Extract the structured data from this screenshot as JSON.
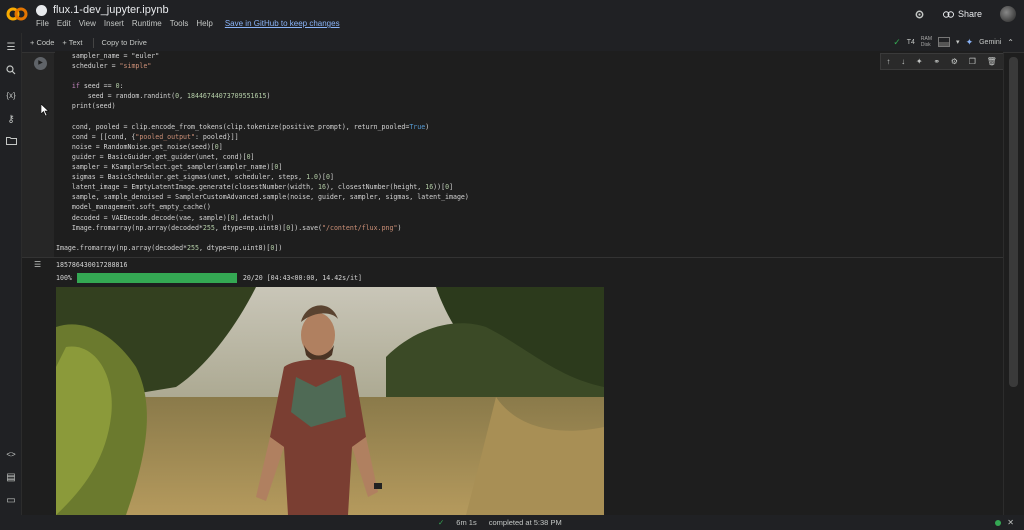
{
  "app": {
    "notebook_title": "flux.1-dev_jupyter.ipynb",
    "menu": [
      "File",
      "Edit",
      "View",
      "Insert",
      "Runtime",
      "Tools",
      "Help"
    ],
    "save_link": "Save in GitHub to keep changes",
    "share_label": "Share"
  },
  "toolbar": {
    "code_label": "+ Code",
    "text_label": "+ Text",
    "copy_label": "Copy to Drive",
    "runtime_label": "T4",
    "ram_label": "RAM",
    "disk_label": "Disk",
    "gemini_label": "Gemini"
  },
  "code_lines": [
    {
      "segments": [
        {
          "t": "    sampler_name = \"euler\"",
          "c": ""
        }
      ]
    },
    {
      "segments": [
        {
          "t": "    scheduler = ",
          "c": ""
        },
        {
          "t": "\"simple\"",
          "c": "str"
        }
      ]
    },
    {
      "segments": [
        {
          "t": "",
          "c": ""
        }
      ]
    },
    {
      "segments": [
        {
          "t": "    ",
          "c": ""
        },
        {
          "t": "if",
          "c": "kw"
        },
        {
          "t": " seed == ",
          "c": ""
        },
        {
          "t": "0",
          "c": "num"
        },
        {
          "t": ":",
          "c": ""
        }
      ]
    },
    {
      "segments": [
        {
          "t": "        seed = random.randint(",
          "c": ""
        },
        {
          "t": "0",
          "c": "num"
        },
        {
          "t": ", ",
          "c": ""
        },
        {
          "t": "18446744073709551615",
          "c": "num"
        },
        {
          "t": ")",
          "c": ""
        }
      ]
    },
    {
      "segments": [
        {
          "t": "    print(seed)",
          "c": ""
        }
      ]
    },
    {
      "segments": [
        {
          "t": "",
          "c": ""
        }
      ]
    },
    {
      "segments": [
        {
          "t": "    cond, pooled = clip.encode_from_tokens(clip.tokenize(positive_prompt), return_pooled=",
          "c": ""
        },
        {
          "t": "True",
          "c": "bool"
        },
        {
          "t": ")",
          "c": ""
        }
      ]
    },
    {
      "segments": [
        {
          "t": "    cond = [[cond, {",
          "c": ""
        },
        {
          "t": "\"pooled_output\"",
          "c": "str"
        },
        {
          "t": ": pooled}]]",
          "c": ""
        }
      ]
    },
    {
      "segments": [
        {
          "t": "    noise = RandomNoise.get_noise(seed)[",
          "c": ""
        },
        {
          "t": "0",
          "c": "num"
        },
        {
          "t": "]",
          "c": ""
        }
      ]
    },
    {
      "segments": [
        {
          "t": "    guider = BasicGuider.get_guider(unet, cond)[",
          "c": ""
        },
        {
          "t": "0",
          "c": "num"
        },
        {
          "t": "]",
          "c": ""
        }
      ]
    },
    {
      "segments": [
        {
          "t": "    sampler = KSamplerSelect.get_sampler(sampler_name)[",
          "c": ""
        },
        {
          "t": "0",
          "c": "num"
        },
        {
          "t": "]",
          "c": ""
        }
      ]
    },
    {
      "segments": [
        {
          "t": "    sigmas = BasicScheduler.get_sigmas(unet, scheduler, steps, ",
          "c": ""
        },
        {
          "t": "1.0",
          "c": "num"
        },
        {
          "t": ")[",
          "c": ""
        },
        {
          "t": "0",
          "c": "num"
        },
        {
          "t": "]",
          "c": ""
        }
      ]
    },
    {
      "segments": [
        {
          "t": "    latent_image = EmptyLatentImage.generate(closestNumber(width, ",
          "c": ""
        },
        {
          "t": "16",
          "c": "num"
        },
        {
          "t": "), closestNumber(height, ",
          "c": ""
        },
        {
          "t": "16",
          "c": "num"
        },
        {
          "t": "))[",
          "c": ""
        },
        {
          "t": "0",
          "c": "num"
        },
        {
          "t": "]",
          "c": ""
        }
      ]
    },
    {
      "segments": [
        {
          "t": "    sample, sample_denoised = SamplerCustomAdvanced.sample(noise, guider, sampler, sigmas, latent_image)",
          "c": ""
        }
      ]
    },
    {
      "segments": [
        {
          "t": "    model_management.soft_empty_cache()",
          "c": ""
        }
      ]
    },
    {
      "segments": [
        {
          "t": "    decoded = VAEDecode.decode(vae, sample)[",
          "c": ""
        },
        {
          "t": "0",
          "c": "num"
        },
        {
          "t": "].detach()",
          "c": ""
        }
      ]
    },
    {
      "segments": [
        {
          "t": "    Image.fromarray(np.array(decoded*",
          "c": ""
        },
        {
          "t": "255",
          "c": "num"
        },
        {
          "t": ", dtype=np.uint8)[",
          "c": ""
        },
        {
          "t": "0",
          "c": "num"
        },
        {
          "t": "]).save(",
          "c": ""
        },
        {
          "t": "\"/content/flux.png\"",
          "c": "str"
        },
        {
          "t": ")",
          "c": ""
        }
      ]
    },
    {
      "segments": [
        {
          "t": "",
          "c": ""
        }
      ]
    },
    {
      "segments": [
        {
          "t": "Image.fromarray(np.array(decoded*",
          "c": ""
        },
        {
          "t": "255",
          "c": "num"
        },
        {
          "t": ", dtype=np.uint8)[",
          "c": ""
        },
        {
          "t": "0",
          "c": "num"
        },
        {
          "t": "])",
          "c": ""
        }
      ]
    }
  ],
  "output": {
    "seed_value": "185786430017288816",
    "progress_percent": 100,
    "progress_label": "100%",
    "progress_stats": "20/20 [04:43<00:00, 14.42s/it]"
  },
  "status": {
    "elapsed": "6m 1s",
    "completed": "completed at 5:38 PM"
  },
  "colors": {
    "accent_green": "#34a853",
    "link_blue": "#8ab4f8",
    "orange_logo": "#f9ab00"
  }
}
